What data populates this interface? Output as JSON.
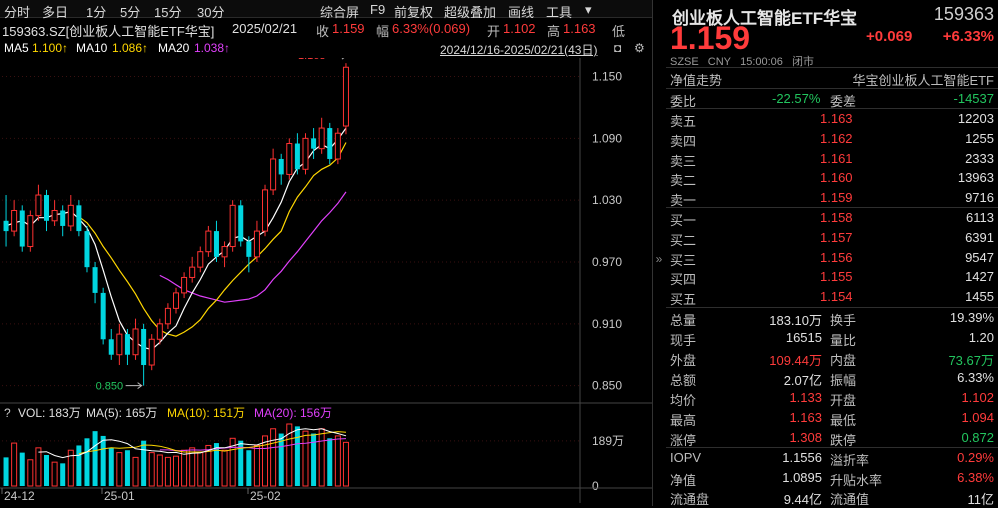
{
  "toolbar": {
    "items": [
      "分时",
      "多日",
      "1分",
      "5分",
      "15分",
      "30分",
      "综合屏",
      "F9",
      "前复权",
      "超级叠加",
      "画线",
      "工具"
    ],
    "gear_icon": "gear-icon"
  },
  "info": {
    "security": "159363.SZ[创业板人工智能ETF华宝]",
    "date": "2025/02/21",
    "close_label": "收",
    "close_value": "1.159",
    "amp_label": "幅",
    "amp_value": "6.33%(0.069)",
    "open_label": "开",
    "open_value": "1.102",
    "high_label": "高",
    "high_value": "1.163",
    "low_label": "低"
  },
  "ma": {
    "ma5": "MA5",
    "ma5_value": "1.100↑",
    "ma10": "MA10",
    "ma10_value": "1.086↑",
    "ma20": "MA20",
    "ma20_value": "1.038↑",
    "range": "2024/12/16-2025/02/21(43日)",
    "colors": {
      "ma5": "#ffffff",
      "ma10": "#ffd700",
      "ma20": "#e040fb"
    }
  },
  "chart_data": {
    "type": "candlestick",
    "price_axis": [
      "1.150",
      "1.090",
      "1.030",
      "0.970",
      "0.910",
      "0.850"
    ],
    "price_ylim": [
      0.838,
      1.168
    ],
    "high_marker": "1.163",
    "low_marker": "0.850",
    "volume_label": "VOL: 183万",
    "volume_ma5": "MA(5): 165万",
    "volume_ma10": "MA(10): 151万",
    "volume_ma20": "MA(20): 156万",
    "volume_axis": [
      "189万",
      "0"
    ],
    "x_labels": [
      "24-12",
      "25-01",
      "25-02"
    ],
    "candles": [
      [
        1.01,
        1.0,
        1.035,
        0.985
      ],
      [
        1.0,
        1.02,
        1.03,
        0.995
      ],
      [
        1.02,
        0.985,
        1.025,
        0.98
      ],
      [
        0.985,
        1.015,
        1.02,
        0.98
      ],
      [
        1.015,
        1.035,
        1.045,
        1.01
      ],
      [
        1.035,
        1.01,
        1.04,
        1.0
      ],
      [
        1.01,
        1.02,
        1.03,
        1.005
      ],
      [
        1.02,
        1.005,
        1.025,
        0.995
      ],
      [
        1.005,
        1.025,
        1.035,
        1.0
      ],
      [
        1.025,
        1.0,
        1.03,
        0.995
      ],
      [
        1.0,
        0.965,
        1.005,
        0.96
      ],
      [
        0.965,
        0.94,
        0.97,
        0.93
      ],
      [
        0.94,
        0.895,
        0.945,
        0.89
      ],
      [
        0.895,
        0.88,
        0.905,
        0.875
      ],
      [
        0.88,
        0.9,
        0.91,
        0.87
      ],
      [
        0.9,
        0.88,
        0.905,
        0.87
      ],
      [
        0.88,
        0.905,
        0.915,
        0.875
      ],
      [
        0.905,
        0.87,
        0.91,
        0.85
      ],
      [
        0.87,
        0.895,
        0.9,
        0.865
      ],
      [
        0.895,
        0.91,
        0.915,
        0.89
      ],
      [
        0.91,
        0.925,
        0.93,
        0.905
      ],
      [
        0.925,
        0.94,
        0.945,
        0.92
      ],
      [
        0.94,
        0.955,
        0.96,
        0.935
      ],
      [
        0.955,
        0.965,
        0.975,
        0.95
      ],
      [
        0.965,
        0.98,
        0.985,
        0.96
      ],
      [
        0.98,
        1.0,
        1.005,
        0.975
      ],
      [
        1.0,
        0.975,
        1.01,
        0.97
      ],
      [
        0.975,
        0.985,
        0.99,
        0.965
      ],
      [
        0.985,
        1.025,
        1.03,
        0.98
      ],
      [
        1.025,
        0.99,
        1.03,
        0.985
      ],
      [
        0.99,
        0.975,
        0.995,
        0.96
      ],
      [
        0.975,
        1.0,
        1.01,
        0.97
      ],
      [
        1.0,
        1.04,
        1.045,
        0.995
      ],
      [
        1.04,
        1.07,
        1.08,
        1.035
      ],
      [
        1.07,
        1.055,
        1.075,
        1.045
      ],
      [
        1.055,
        1.085,
        1.09,
        1.05
      ],
      [
        1.085,
        1.06,
        1.095,
        1.055
      ],
      [
        1.06,
        1.09,
        1.095,
        1.055
      ],
      [
        1.09,
        1.08,
        1.1,
        1.07
      ],
      [
        1.08,
        1.1,
        1.11,
        1.075
      ],
      [
        1.1,
        1.07,
        1.105,
        1.065
      ],
      [
        1.07,
        1.095,
        1.1,
        1.065
      ],
      [
        1.102,
        1.159,
        1.163,
        1.094
      ]
    ],
    "ma5": [
      1.005,
      1.008,
      1.01,
      1.005,
      1.013,
      1.013,
      1.016,
      1.017,
      1.019,
      1.012,
      1.003,
      0.987,
      0.962,
      0.936,
      0.913,
      0.899,
      0.892,
      0.887,
      0.885,
      0.892,
      0.901,
      0.908,
      0.925,
      0.94,
      0.953,
      0.968,
      0.975,
      0.981,
      0.993,
      0.995,
      0.99,
      0.995,
      1.0,
      1.013,
      1.028,
      1.048,
      1.061,
      1.067,
      1.078,
      1.084,
      1.08,
      1.089,
      1.1
    ],
    "ma10": [
      null,
      null,
      null,
      null,
      null,
      null,
      null,
      null,
      null,
      1.014,
      1.008,
      0.998,
      0.985,
      0.974,
      0.962,
      0.951,
      0.939,
      0.925,
      0.913,
      0.904,
      0.9,
      0.898,
      0.902,
      0.907,
      0.914,
      0.925,
      0.933,
      0.943,
      0.952,
      0.96,
      0.968,
      0.975,
      0.983,
      0.992,
      1.0,
      1.019,
      1.033,
      1.043,
      1.054,
      1.06,
      1.064,
      1.071,
      1.086
    ],
    "ma20": [
      null,
      null,
      null,
      null,
      null,
      null,
      null,
      null,
      null,
      null,
      null,
      null,
      null,
      null,
      null,
      null,
      null,
      null,
      null,
      0.957,
      0.953,
      0.948,
      0.943,
      0.94,
      0.937,
      0.935,
      0.933,
      0.931,
      0.932,
      0.933,
      0.934,
      0.937,
      0.943,
      0.953,
      0.961,
      0.971,
      0.98,
      0.99,
      1.0,
      1.01,
      1.018,
      1.027,
      1.038
    ],
    "volumes": [
      120,
      180,
      140,
      110,
      160,
      130,
      100,
      95,
      150,
      170,
      200,
      230,
      210,
      160,
      140,
      150,
      120,
      190,
      140,
      130,
      120,
      125,
      150,
      160,
      140,
      170,
      180,
      150,
      200,
      190,
      150,
      170,
      210,
      240,
      220,
      260,
      250,
      230,
      220,
      240,
      200,
      210,
      183
    ],
    "vol_ylim": [
      0,
      260
    ]
  },
  "right": {
    "title": "创业板人工智能ETF华宝",
    "code": "159363",
    "price": "1.159",
    "change": "+0.069",
    "pct": "+6.33%",
    "meta": [
      "SZSE",
      "CNY",
      "15:00:06",
      "闭市"
    ],
    "nav_label": "净值走势",
    "nav_name": "华宝创业板人工智能ETF",
    "weibi_label": "委比",
    "weibi_value": "-22.57%",
    "weicha_label": "委差",
    "weicha_value": "-14537",
    "sells": [
      {
        "label": "卖五",
        "price": "1.163",
        "vol": "12203"
      },
      {
        "label": "卖四",
        "price": "1.162",
        "vol": "1255"
      },
      {
        "label": "卖三",
        "price": "1.161",
        "vol": "2333"
      },
      {
        "label": "卖二",
        "price": "1.160",
        "vol": "13963"
      },
      {
        "label": "卖一",
        "price": "1.159",
        "vol": "9716"
      }
    ],
    "buys": [
      {
        "label": "买一",
        "price": "1.158",
        "vol": "6113"
      },
      {
        "label": "买二",
        "price": "1.157",
        "vol": "6391"
      },
      {
        "label": "买三",
        "price": "1.156",
        "vol": "9547"
      },
      {
        "label": "买四",
        "price": "1.155",
        "vol": "1427"
      },
      {
        "label": "买五",
        "price": "1.154",
        "vol": "1455"
      }
    ],
    "stats": [
      {
        "l1": "总量",
        "v1": "183.10万",
        "c1": "white",
        "l2": "换手",
        "v2": "19.39%",
        "c2": "white"
      },
      {
        "l1": "现手",
        "v1": "16515",
        "c1": "white",
        "l2": "量比",
        "v2": "1.20",
        "c2": "white"
      },
      {
        "l1": "外盘",
        "v1": "109.44万",
        "c1": "red",
        "l2": "内盘",
        "v2": "73.67万",
        "c2": "green"
      },
      {
        "l1": "总额",
        "v1": "2.07亿",
        "c1": "white",
        "l2": "振幅",
        "v2": "6.33%",
        "c2": "white"
      },
      {
        "l1": "均价",
        "v1": "1.133",
        "c1": "red",
        "l2": "开盘",
        "v2": "1.102",
        "c2": "red"
      },
      {
        "l1": "最高",
        "v1": "1.163",
        "c1": "red",
        "l2": "最低",
        "v2": "1.094",
        "c2": "red"
      },
      {
        "l1": "涨停",
        "v1": "1.308",
        "c1": "red",
        "l2": "跌停",
        "v2": "0.872",
        "c2": "green"
      }
    ],
    "stats2": [
      {
        "l1": "IOPV",
        "v1": "1.1556",
        "c1": "white",
        "l2": "溢折率",
        "v2": "0.29%",
        "c2": "red"
      },
      {
        "l1": "净值",
        "v1": "1.0895",
        "c1": "white",
        "l2": "升贴水率",
        "v2": "6.38%",
        "c2": "red"
      },
      {
        "l1": "流通盘",
        "v1": "9.44亿",
        "c1": "white",
        "l2": "流通值",
        "v2": "11亿",
        "c2": "white"
      }
    ]
  }
}
